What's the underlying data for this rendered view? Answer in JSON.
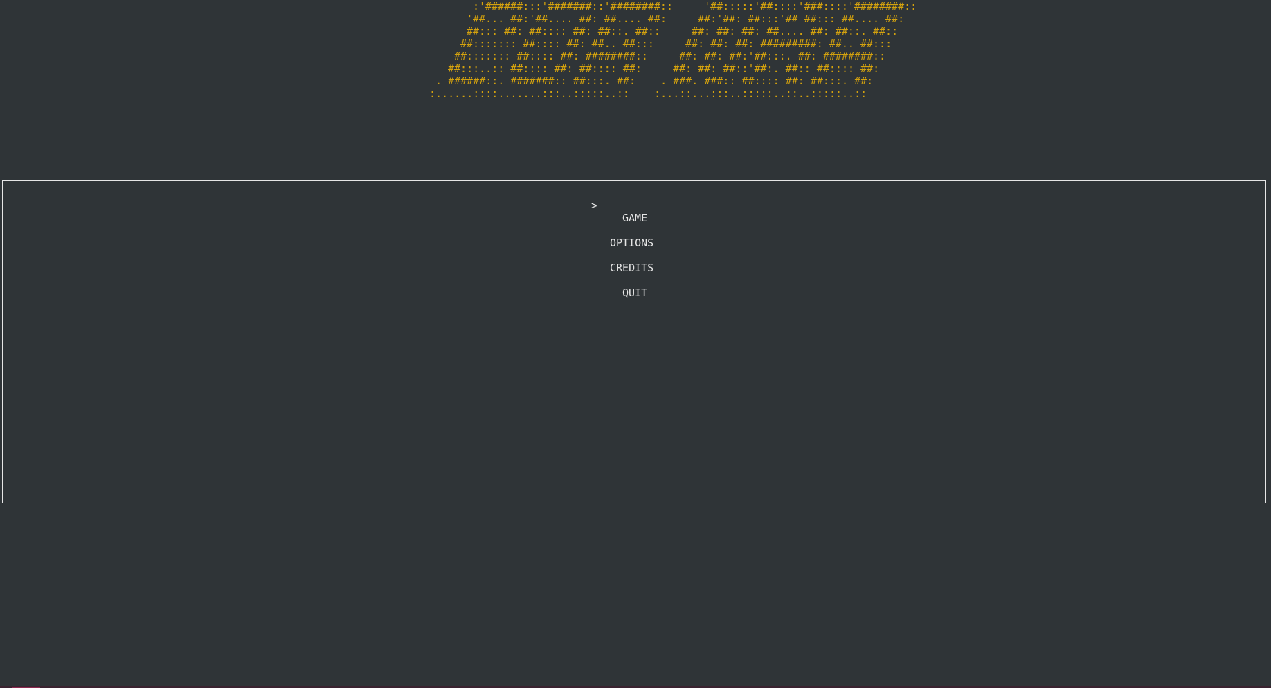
{
  "banner": {
    "lines": [
      ":'######:::'#######::'########::     '##:::::'##::::'###::::'########::",
      "'##... ##:'##.... ##: ##.... ##:     ##:'##: ##:::'## ##::: ##.... ##:",
      "##::: ##: ##:::: ##: ##::. ##::     ##: ##: ##: ##.... ##: ##::. ##::",
      "##::::::: ##:::: ##: ##.. ##:::     ##: ##: ##: #########: ##.. ##:::",
      "##::::::: ##:::: ##: ########::     ##: ##: ##:'##:::. ##: ########::",
      "##:::..:: ##:::: ##: ##:::: ##:     ##: ##: ##::'##:. ##:: ##:::: ##:",
      ". ######::. #######:: ##:::. ##:    . ###. ###:: ##:::: ##: ##:::. ##:",
      ":......::::.......:::..:::::..::    :...::...:::..:::::..::..:::::..::"
    ],
    "color": "#d4a20e"
  },
  "menu": {
    "cursor": ">",
    "items": [
      {
        "label": "GAME"
      },
      {
        "label": "OPTIONS"
      },
      {
        "label": "CREDITS"
      },
      {
        "label": "QUIT"
      }
    ],
    "selected_index": 0,
    "text_color": "#e6e6e6"
  },
  "colors": {
    "background": "#2f3437",
    "border": "#e6e6e6"
  }
}
